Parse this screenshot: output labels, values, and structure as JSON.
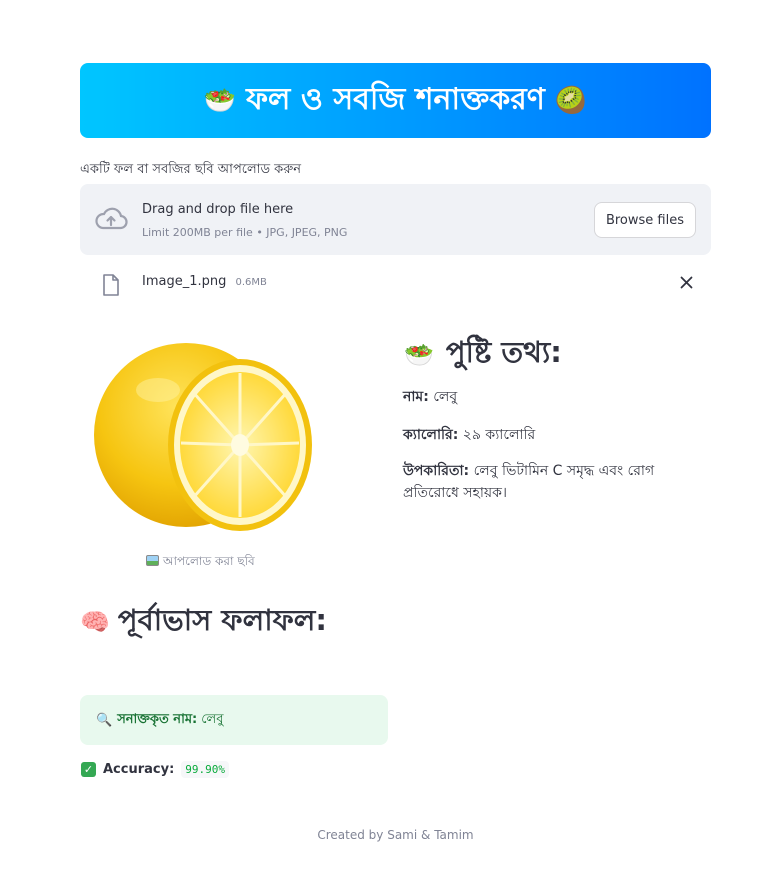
{
  "banner": {
    "left_emoji": "🥗",
    "title": "ফল ও সবজি শনাক্তকরণ",
    "right_emoji": "🥝"
  },
  "uploader": {
    "label": "একটি ফল বা সবজির ছবি আপলোড করুন",
    "drop_title": "Drag and drop file here",
    "drop_subtitle": "Limit 200MB per file • JPG, JPEG, PNG",
    "browse_label": "Browse files",
    "icon": "cloud-upload-icon"
  },
  "file": {
    "name": "Image_1.png",
    "size": "0.6MB",
    "icon": "file-icon"
  },
  "image": {
    "caption": "আপলোড করা ছবি",
    "subject": "lemon"
  },
  "nutrition": {
    "emoji": "🥗",
    "heading": "পুষ্টি তথ্য:",
    "name_label": "নাম:",
    "name_value": "লেবু",
    "calorie_label": "ক্যালোরি:",
    "calorie_value": "২৯ ক্যালোরি",
    "benefit_label": "উপকারিতা:",
    "benefit_value": "লেবু ভিটামিন C সমৃদ্ধ এবং রোগ প্রতিরোধে সহায়ক।"
  },
  "prediction": {
    "emoji": "🧠",
    "heading": "পূর্বাভাস ফলাফল:",
    "result_emoji": "🔍",
    "result_label": "সনাক্তকৃত নাম:",
    "result_value": "লেবু",
    "accuracy_label": "Accuracy:",
    "accuracy_value": "99.90%"
  },
  "footer": {
    "text": "Created by Sami & Tamim"
  },
  "colors": {
    "banner_start": "#00c6ff",
    "banner_end": "#0072ff",
    "success_bg": "#e8f9ee",
    "success_text": "#177233"
  }
}
